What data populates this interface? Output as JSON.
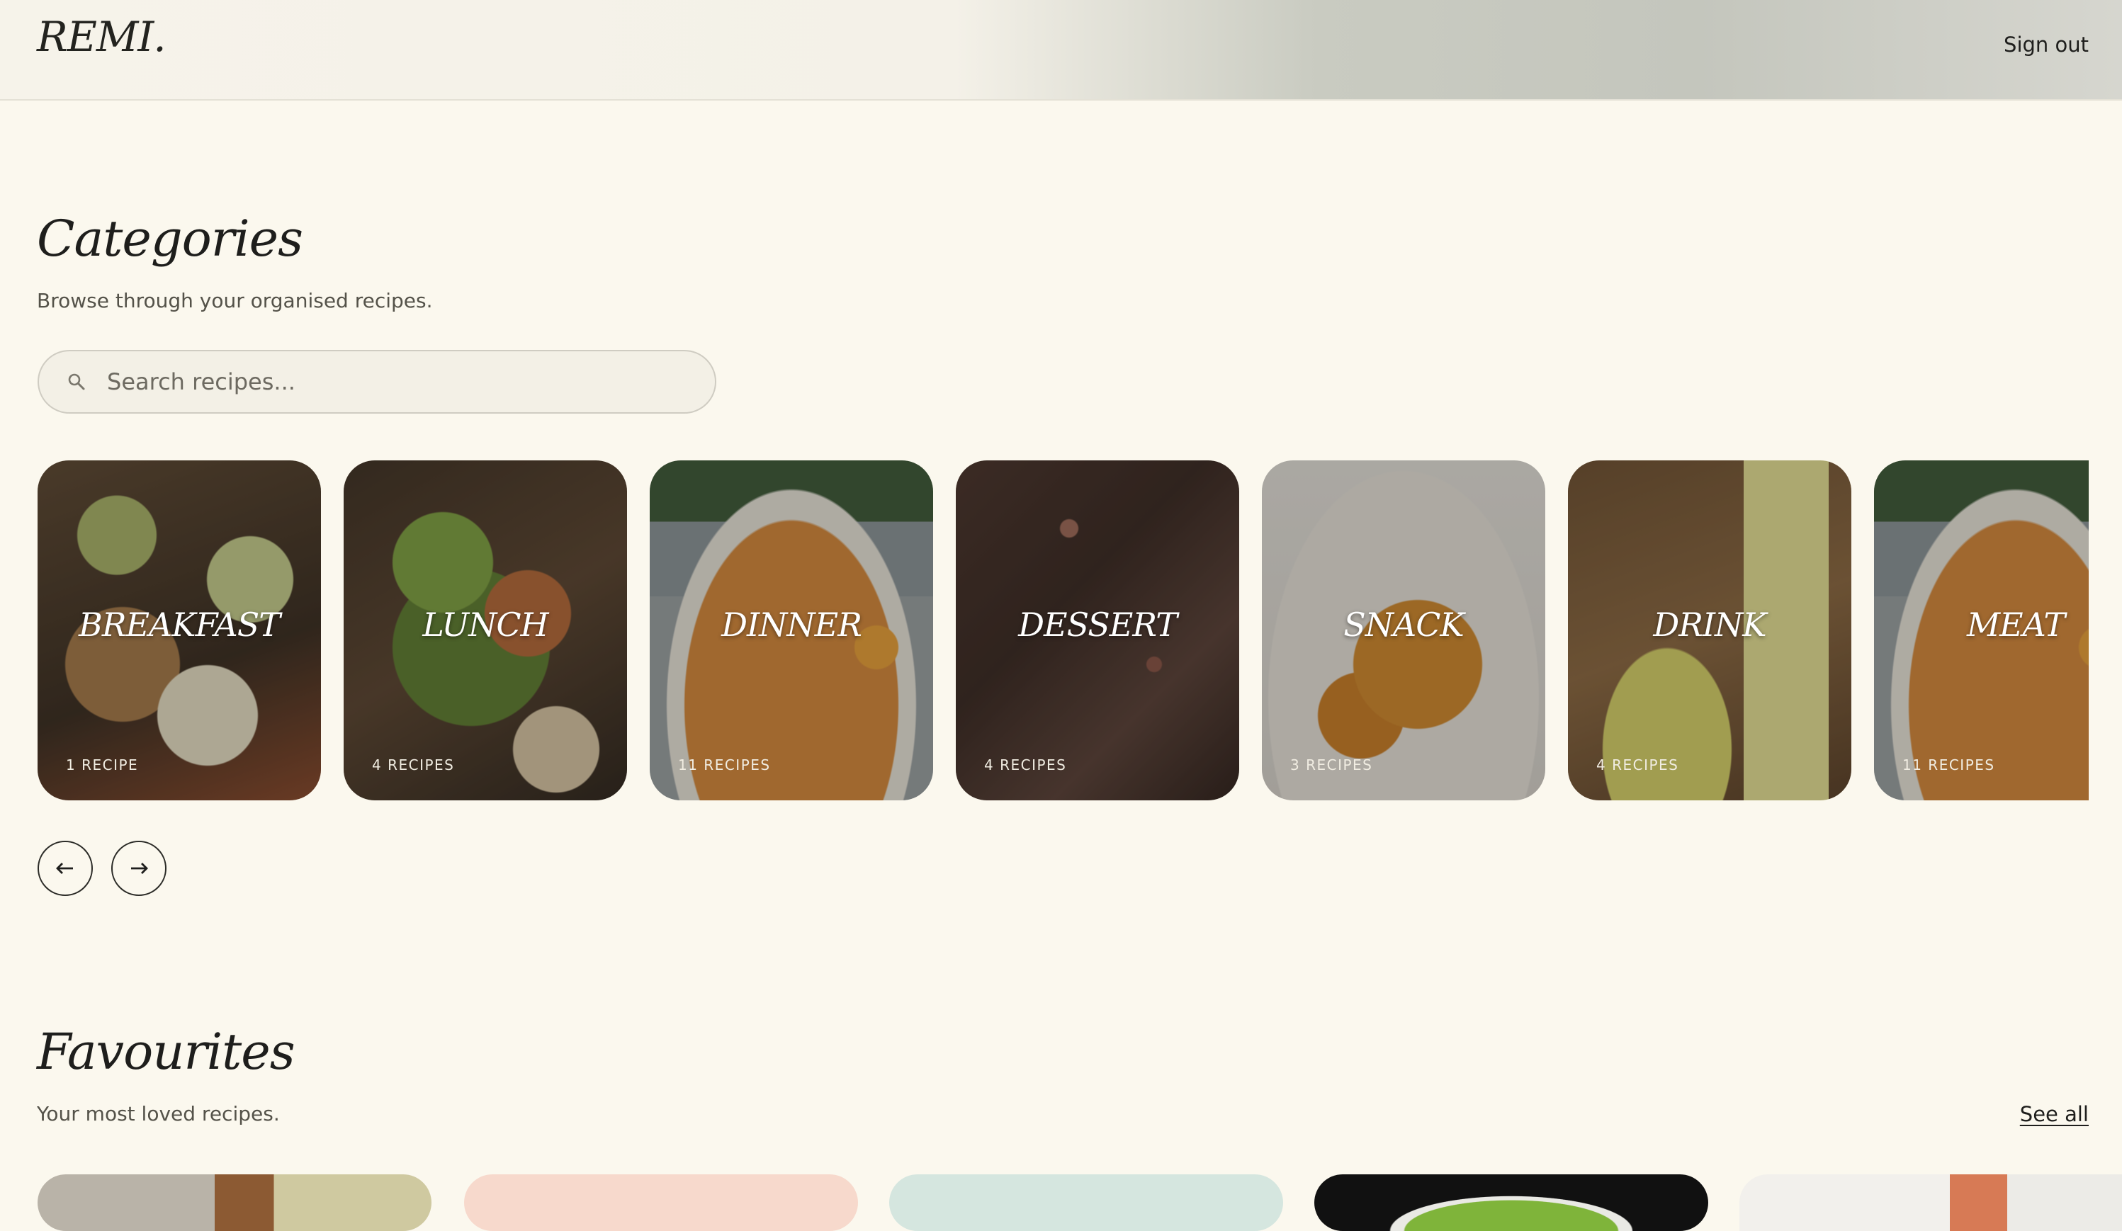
{
  "header": {
    "logo": "REMI.",
    "signout_label": "Sign out"
  },
  "categories": {
    "title": "Categories",
    "subtitle": "Browse through your organised recipes.",
    "search_placeholder": "Search recipes...",
    "cards": [
      {
        "name": "BREAKFAST",
        "count": "1 RECIPE"
      },
      {
        "name": "LUNCH",
        "count": "4 RECIPES"
      },
      {
        "name": "DINNER",
        "count": "11 RECIPES"
      },
      {
        "name": "DESSERT",
        "count": "4 RECIPES"
      },
      {
        "name": "SNACK",
        "count": "3 RECIPES"
      },
      {
        "name": "DRINK",
        "count": "4 RECIPES"
      },
      {
        "name": "MEAT",
        "count": "11 RECIPES"
      }
    ],
    "prev_icon": "arrow-left-icon",
    "next_icon": "arrow-right-icon"
  },
  "favourites": {
    "title": "Favourites",
    "subtitle": "Your most loved recipes.",
    "see_all_label": "See all"
  },
  "colors": {
    "background": "#fbf8ee",
    "text": "#1e1e1c"
  }
}
